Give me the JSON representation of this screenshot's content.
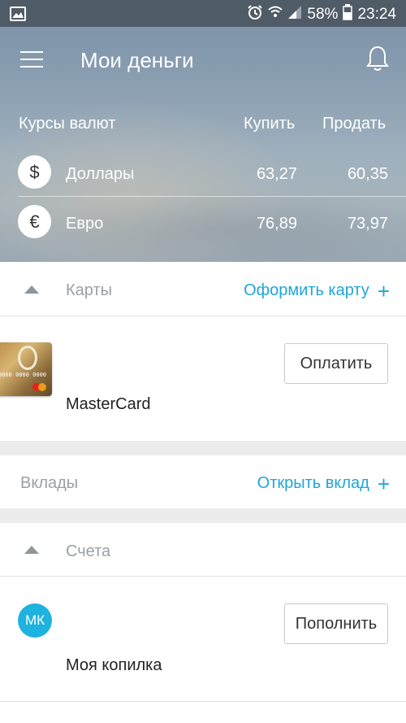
{
  "status_bar": {
    "battery_percent": "58%",
    "time": "23:24",
    "icons": [
      "image-icon",
      "alarm-icon",
      "wifi-icon",
      "signal-icon",
      "battery-icon"
    ]
  },
  "header": {
    "title": "Мои деньги",
    "menu_icon": "menu-icon",
    "bell_icon": "bell-icon"
  },
  "rates": {
    "label": "Курсы валют",
    "buy_label": "Купить",
    "sell_label": "Продать",
    "items": [
      {
        "symbol": "$",
        "name": "Доллары",
        "buy": "63,27",
        "sell": "60,35"
      },
      {
        "symbol": "€",
        "name": "Евро",
        "buy": "76,89",
        "sell": "73,97"
      }
    ]
  },
  "cards": {
    "title": "Карты",
    "action": "Оформить карту",
    "item": {
      "name": "MasterCard",
      "button": "Оплатить",
      "card_number_text": "0000 0000 0000"
    }
  },
  "deposits": {
    "title": "Вклады",
    "action": "Открыть вклад"
  },
  "accounts": {
    "title": "Счета",
    "item": {
      "avatar_initials": "МК",
      "name": "Моя копилка",
      "button": "Пополнить"
    }
  },
  "colors": {
    "accent": "#1ea6d8",
    "status_bar": "#4f5b66",
    "avatar": "#1eb2de"
  }
}
